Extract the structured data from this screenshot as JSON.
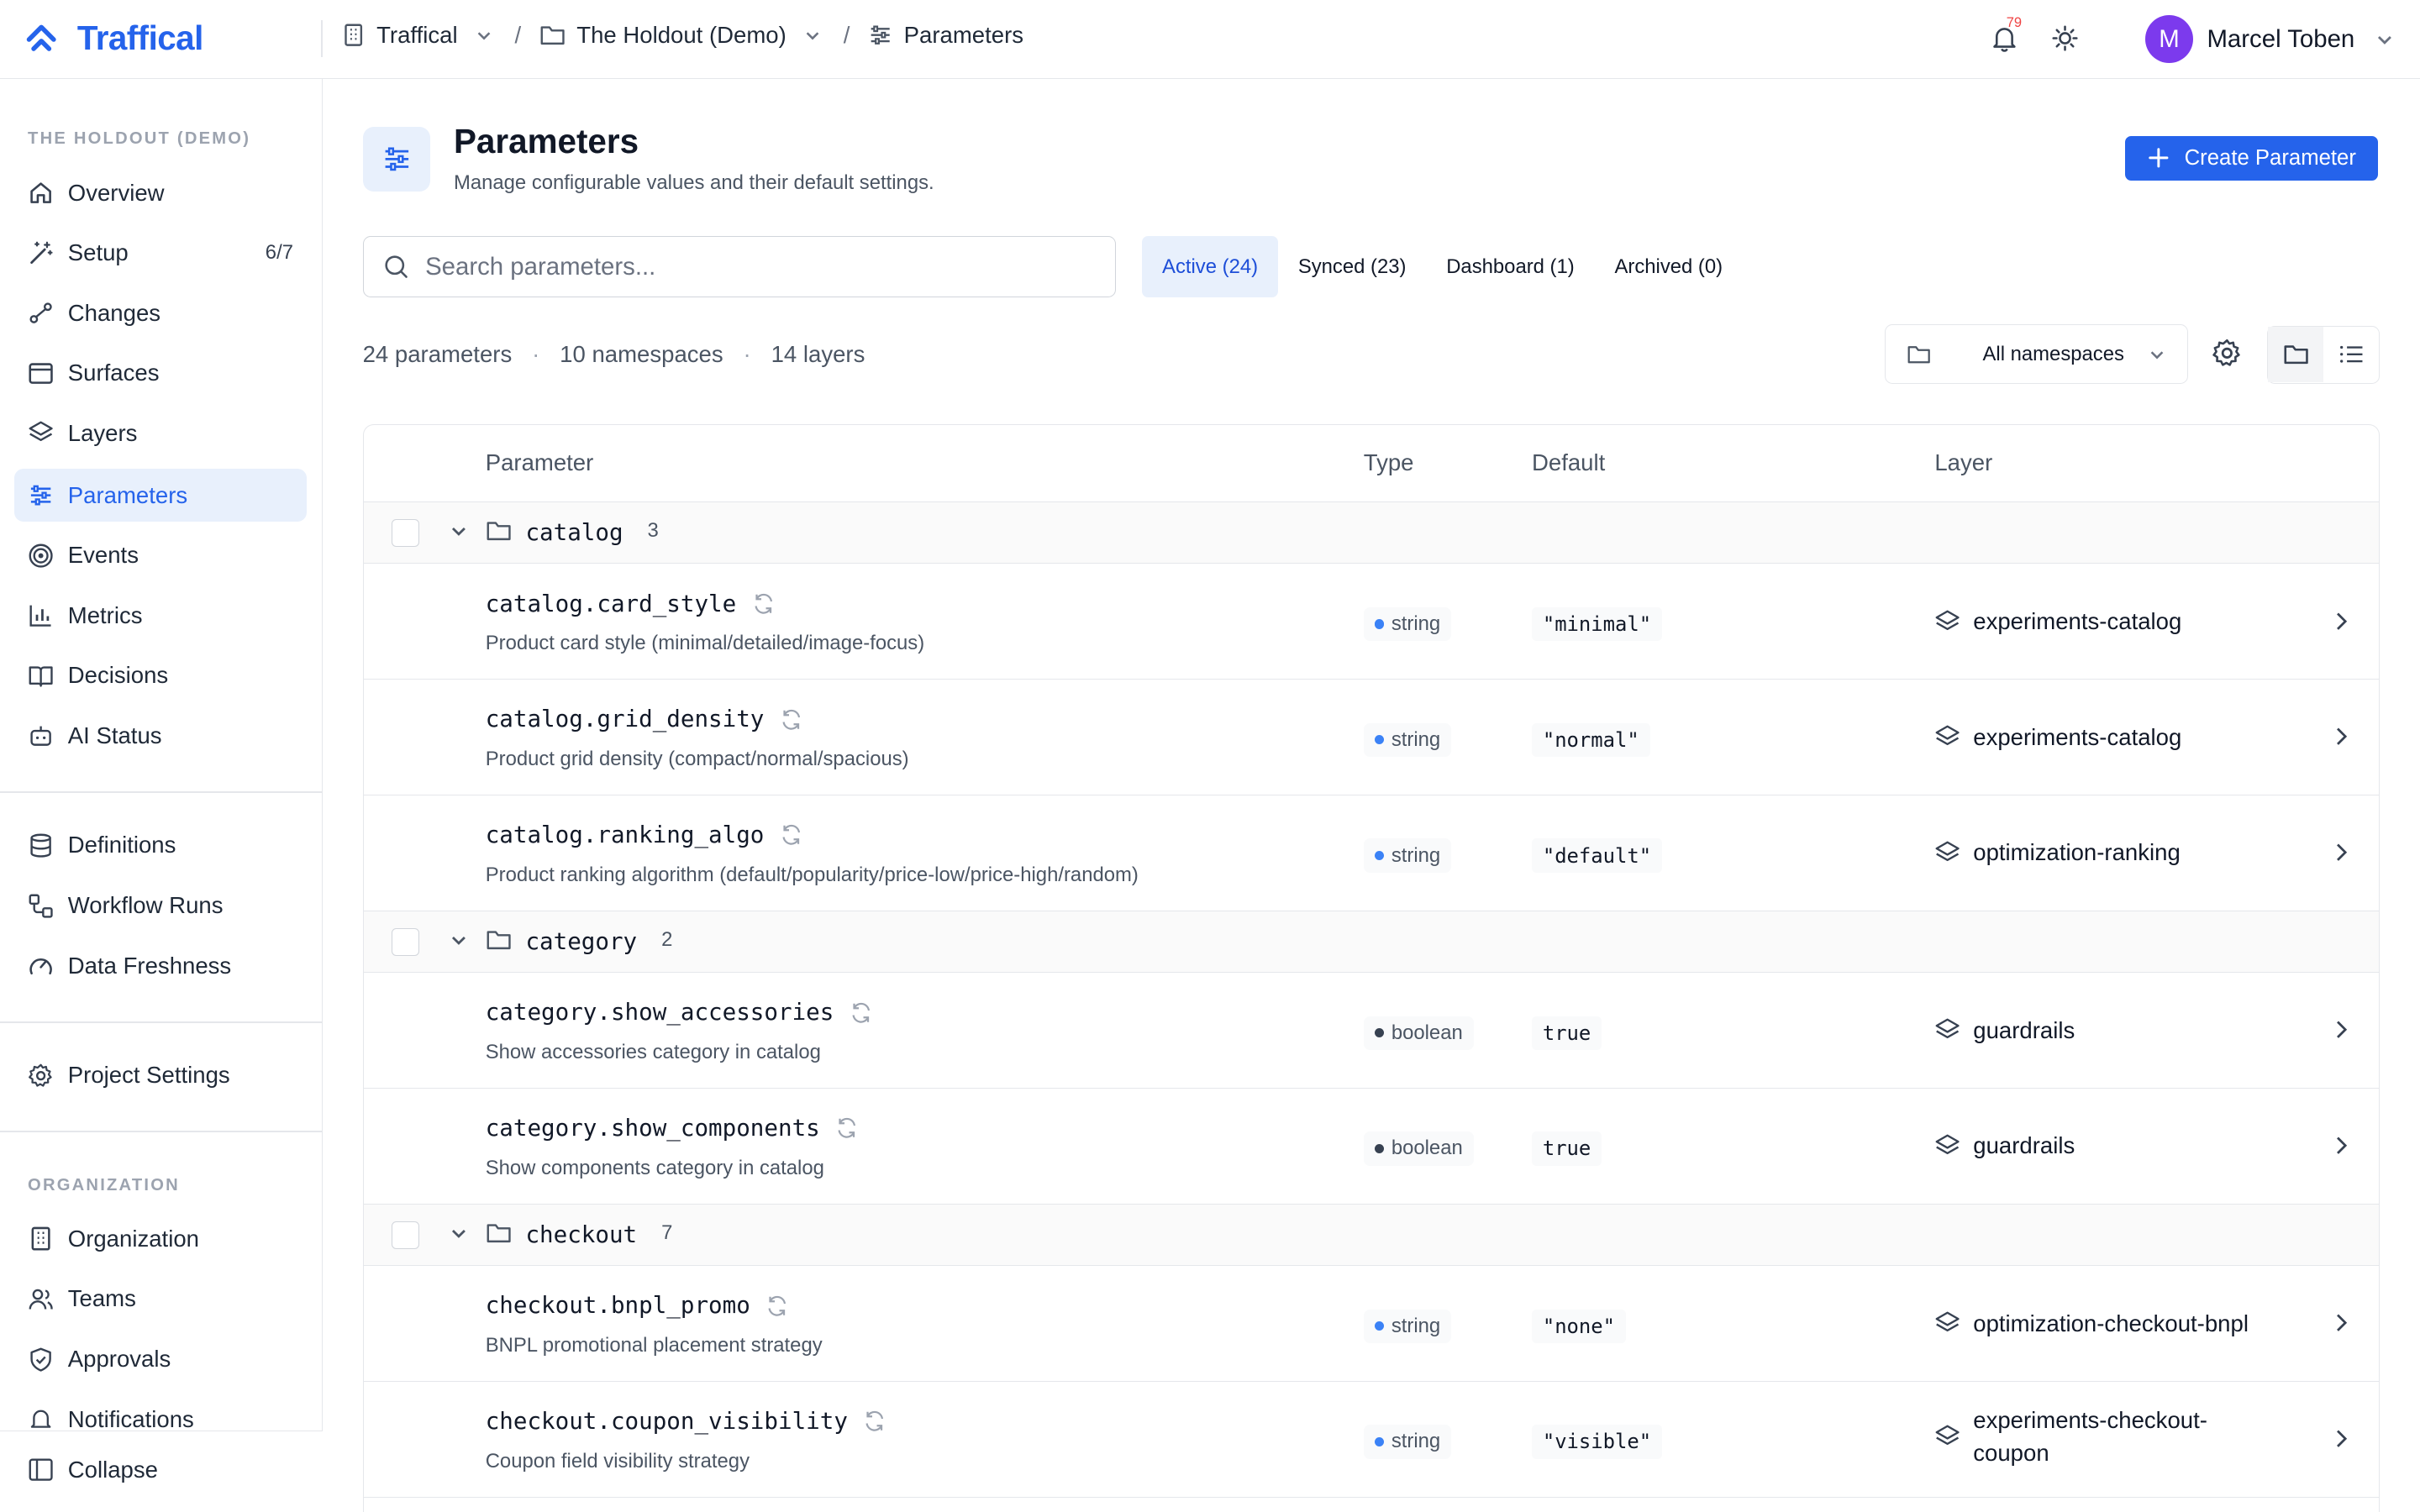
{
  "brand": {
    "name": "Traffical",
    "color": "#2563eb"
  },
  "breadcrumb": {
    "org": "Traffical",
    "project": "The Holdout (Demo)",
    "page": "Parameters"
  },
  "header": {
    "notification_count": "79",
    "user_name": "Marcel Toben",
    "user_initial": "M"
  },
  "sidebar": {
    "project_heading": "THE HOLDOUT (DEMO)",
    "items": [
      {
        "label": "Overview",
        "icon": "home-icon"
      },
      {
        "label": "Setup",
        "icon": "wand-icon",
        "count": "6/7"
      },
      {
        "label": "Changes",
        "icon": "changes-icon"
      },
      {
        "label": "Surfaces",
        "icon": "window-icon"
      },
      {
        "label": "Layers",
        "icon": "layers-icon"
      },
      {
        "label": "Parameters",
        "icon": "sliders-icon",
        "active": true
      },
      {
        "label": "Events",
        "icon": "target-icon"
      },
      {
        "label": "Metrics",
        "icon": "bar-chart-icon"
      },
      {
        "label": "Decisions",
        "icon": "book-icon"
      },
      {
        "label": "AI Status",
        "icon": "bot-icon"
      }
    ],
    "data_items": [
      {
        "label": "Definitions",
        "icon": "database-icon"
      },
      {
        "label": "Workflow Runs",
        "icon": "workflow-icon"
      },
      {
        "label": "Data Freshness",
        "icon": "gauge-icon"
      }
    ],
    "settings_item": {
      "label": "Project Settings",
      "icon": "gear-icon"
    },
    "org_heading": "ORGANIZATION",
    "org_items": [
      {
        "label": "Organization",
        "icon": "building-icon"
      },
      {
        "label": "Teams",
        "icon": "users-icon"
      },
      {
        "label": "Approvals",
        "icon": "shield-check-icon"
      },
      {
        "label": "Notifications",
        "icon": "bell-icon"
      }
    ],
    "collapse_label": "Collapse"
  },
  "page": {
    "title": "Parameters",
    "subtitle": "Manage configurable values and their default settings.",
    "create_button": "Create Parameter"
  },
  "search": {
    "placeholder": "Search parameters...",
    "value": ""
  },
  "tabs": [
    {
      "label": "Active (24)",
      "active": true
    },
    {
      "label": "Synced (23)"
    },
    {
      "label": "Dashboard (1)"
    },
    {
      "label": "Archived (0)"
    }
  ],
  "stats": {
    "parameters": "24 parameters",
    "namespaces": "10 namespaces",
    "layers": "14 layers"
  },
  "namespace_select": {
    "selected": "All namespaces"
  },
  "table": {
    "columns": {
      "parameter": "Parameter",
      "type": "Type",
      "default": "Default",
      "layer": "Layer"
    },
    "groups": [
      {
        "name": "catalog",
        "count": "3",
        "rows": [
          {
            "key": "catalog.card_style",
            "desc": "Product card style (minimal/detailed/image-focus)",
            "type": "string",
            "default": "\"minimal\"",
            "layer": "experiments-catalog"
          },
          {
            "key": "catalog.grid_density",
            "desc": "Product grid density (compact/normal/spacious)",
            "type": "string",
            "default": "\"normal\"",
            "layer": "experiments-catalog"
          },
          {
            "key": "catalog.ranking_algo",
            "desc": "Product ranking algorithm (default/popularity/price-low/price-high/random)",
            "type": "string",
            "default": "\"default\"",
            "layer": "optimization-ranking"
          }
        ]
      },
      {
        "name": "category",
        "count": "2",
        "rows": [
          {
            "key": "category.show_accessories",
            "desc": "Show accessories category in catalog",
            "type": "boolean",
            "default": "true",
            "layer": "guardrails"
          },
          {
            "key": "category.show_components",
            "desc": "Show components category in catalog",
            "type": "boolean",
            "default": "true",
            "layer": "guardrails"
          }
        ]
      },
      {
        "name": "checkout",
        "count": "7",
        "rows": [
          {
            "key": "checkout.bnpl_promo",
            "desc": "BNPL promotional placement strategy",
            "type": "string",
            "default": "\"none\"",
            "layer": "optimization-checkout-bnpl"
          },
          {
            "key": "checkout.coupon_visibility",
            "desc": "Coupon field visibility strategy",
            "type": "string",
            "default": "\"visible\"",
            "layer_line1": "experiments-checkout-",
            "layer_line2": "coupon"
          }
        ]
      }
    ]
  },
  "colors": {
    "accent": "#2563eb",
    "string_dot": "#3b82f6",
    "boolean_dot": "#374151",
    "notification": "#ef4444",
    "avatar": "#7c3aed"
  }
}
